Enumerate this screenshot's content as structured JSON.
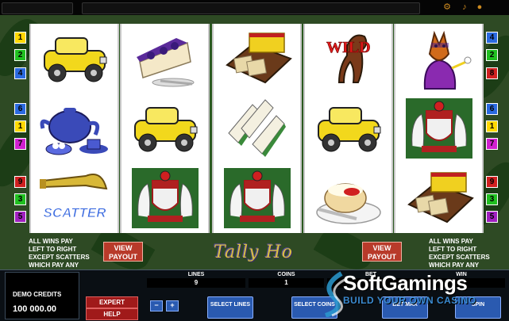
{
  "top_bar": {
    "icons": [
      "gear-icon",
      "speaker-icon",
      "close-icon"
    ]
  },
  "paylines_left": [
    "1",
    "2",
    "4",
    "6",
    "1",
    "7",
    "9",
    "3",
    "5"
  ],
  "paylines_right": [
    "4",
    "2",
    "8",
    "6",
    "1",
    "7",
    "9",
    "3",
    "5"
  ],
  "payline_colors": {
    "1": "#ffd800",
    "2": "#20c020",
    "3": "#20c020",
    "4": "#2a6ae0",
    "5": "#a020c0",
    "6": "#2a6ae0",
    "7": "#d020d0",
    "8": "#d02020",
    "9": "#d02020"
  },
  "reels": [
    [
      "yellow-car",
      "teapot",
      "scatter-horn"
    ],
    [
      "cheesecake",
      "yellow-car",
      "crest"
    ],
    [
      "cheese-crackers",
      "sandwiches",
      "crest"
    ],
    [
      "wild-horse",
      "yellow-car",
      "scone-jam"
    ],
    [
      "fox-lady",
      "crest",
      "cheese-crackers"
    ]
  ],
  "symbol_labels": {
    "wild": "WILD",
    "scatter": "SCATTER"
  },
  "info_left": [
    "ALL WINS PAY",
    "LEFT TO RIGHT",
    "EXCEPT SCATTERS",
    "WHICH PAY ANY"
  ],
  "info_right": [
    "ALL WINS PAY",
    "LEFT TO RIGHT",
    "EXCEPT SCATTERS",
    "WHICH PAY ANY"
  ],
  "view_payout": "VIEW PAYOUT",
  "game_logo": "Tally Ho",
  "credits": {
    "label": "DEMO CREDITS",
    "value": "100 000.00"
  },
  "buttons": {
    "expert": "EXPERT",
    "help": "HELP",
    "minus": "−",
    "plus": "+",
    "select_lines": "SELECT LINES",
    "select_coins": "SELECT COINS",
    "bet_max": "BET MAX",
    "spin": "SPIN"
  },
  "lines": {
    "label": "LINES",
    "value": "9"
  },
  "coins": {
    "label": "COINS",
    "value": "1"
  },
  "bet": {
    "label": "BET",
    "value": ""
  },
  "win": {
    "label": "WIN",
    "value": ""
  },
  "watermark": {
    "title": "SoftGamings",
    "subtitle": "BUILD YOUR OWN CASINO"
  }
}
